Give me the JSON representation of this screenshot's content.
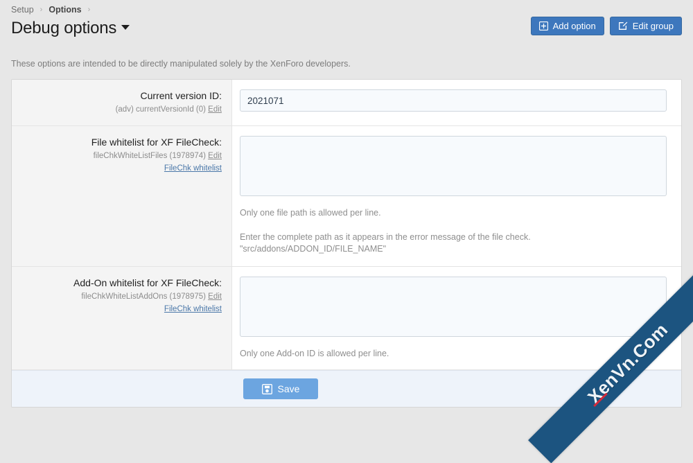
{
  "breadcrumb": {
    "items": [
      {
        "label": "Setup",
        "current": false
      },
      {
        "label": "Options",
        "current": true
      }
    ],
    "separator": "›"
  },
  "header": {
    "title": "Debug options",
    "description": "These options are intended to be directly manipulated solely by the XenForo developers.",
    "buttons": [
      {
        "label": "Add option",
        "icon": "plus-square-icon"
      },
      {
        "label": "Edit group",
        "icon": "pencil-square-icon"
      }
    ]
  },
  "form": {
    "rows": [
      {
        "label": "Current version ID:",
        "sub": "(adv) currentVersionId (0)",
        "edit_label": "Edit",
        "link_label": null,
        "field_type": "input",
        "value": "2021071",
        "hints": []
      },
      {
        "label": "File whitelist for XF FileCheck:",
        "sub": "fileChkWhiteListFiles (1978974)",
        "edit_label": "Edit",
        "link_label": "FileChk whitelist",
        "field_type": "textarea",
        "value": "",
        "hints": [
          "Only one file path is allowed per line.",
          "Enter the complete path as it appears in the error message of the file check. \"src/addons/ADDON_ID/FILE_NAME\""
        ]
      },
      {
        "label": "Add-On whitelist for XF FileCheck:",
        "sub": "fileChkWhiteListAddOns (1978975)",
        "edit_label": "Edit",
        "link_label": "FileChk whitelist",
        "field_type": "textarea",
        "value": "",
        "hints": [
          "Only one Add-on ID is allowed per line."
        ]
      }
    ],
    "footer": {
      "save_label": "Save",
      "save_icon": "save-disk-icon"
    }
  },
  "watermark": {
    "text": "XenVn.Com"
  },
  "colors": {
    "page_background": "#e7e7e7",
    "button_blue": "#3d77bd",
    "save_blue": "#6ca5e0",
    "link_blue": "#4a77a8",
    "label_column": "#f4f4f4",
    "field_background": "#f7fafd",
    "footer_background": "#eef3fa",
    "watermark_blue": "#1c5480",
    "watermark_accent": "#d3293a"
  }
}
